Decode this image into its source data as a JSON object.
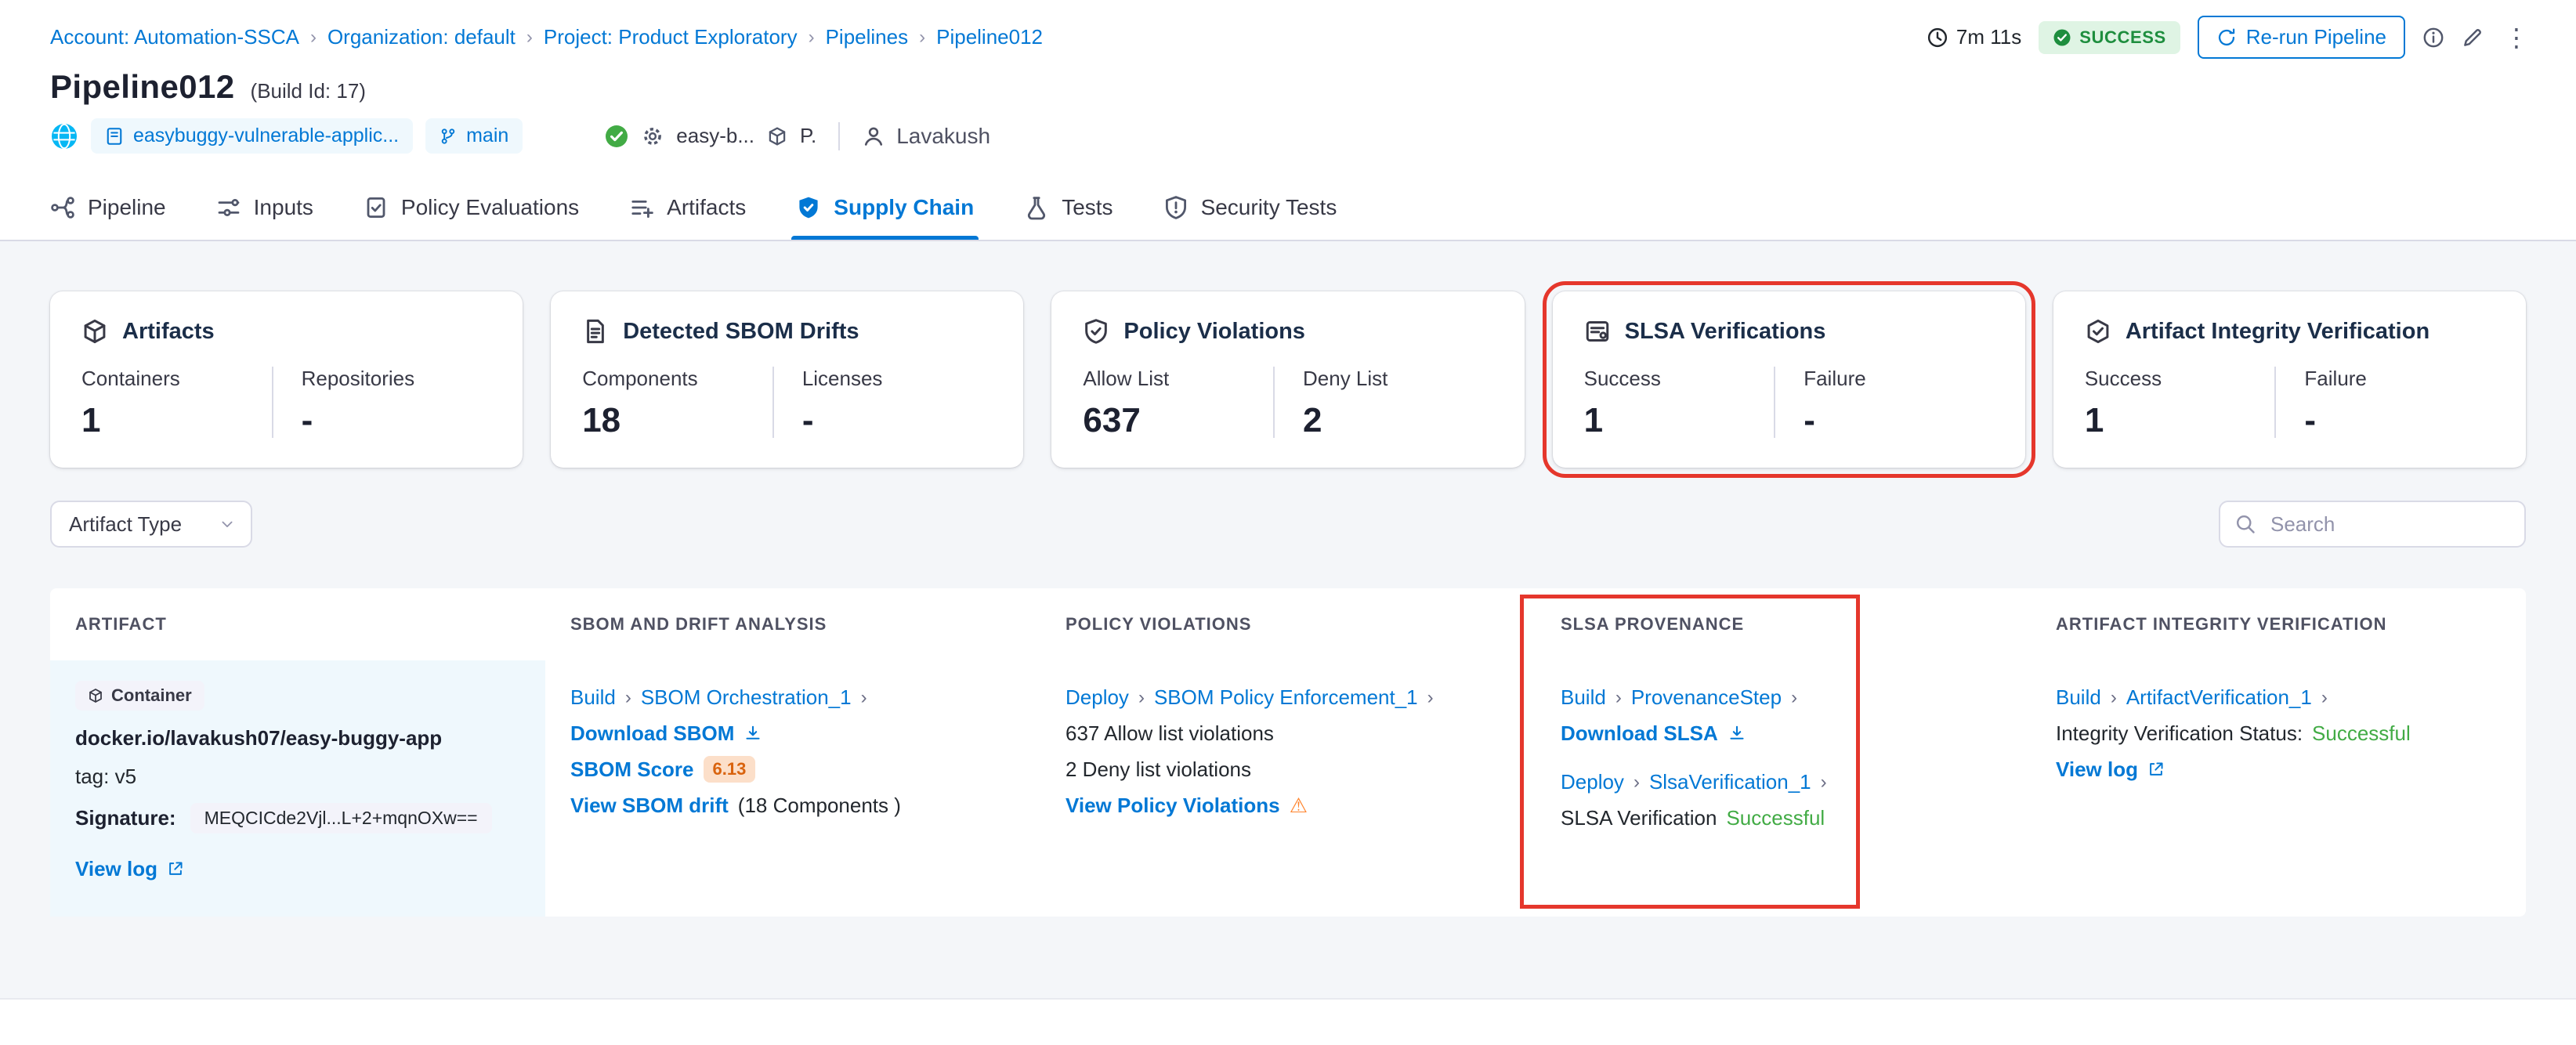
{
  "breadcrumb": {
    "items": [
      "Account: Automation-SSCA",
      "Organization: default",
      "Project: Product Exploratory",
      "Pipelines",
      "Pipeline012"
    ]
  },
  "header": {
    "duration": "7m 11s",
    "status_badge": "SUCCESS",
    "rerun_button": "Re-run Pipeline",
    "title": "Pipeline012",
    "build_id": "(Build Id: 17)"
  },
  "meta": {
    "repo": "easybuggy-vulnerable-applic...",
    "branch": "main",
    "trigger": "easy-b...",
    "trigger_short": "P.",
    "user": "Lavakush"
  },
  "tabs": [
    {
      "label": "Pipeline"
    },
    {
      "label": "Inputs"
    },
    {
      "label": "Policy Evaluations"
    },
    {
      "label": "Artifacts"
    },
    {
      "label": "Supply Chain",
      "active": true
    },
    {
      "label": "Tests"
    },
    {
      "label": "Security Tests"
    }
  ],
  "cards": [
    {
      "title": "Artifacts",
      "columns": [
        {
          "label": "Containers",
          "value": "1"
        },
        {
          "label": "Repositories",
          "value": "-"
        }
      ]
    },
    {
      "title": "Detected SBOM Drifts",
      "columns": [
        {
          "label": "Components",
          "value": "18"
        },
        {
          "label": "Licenses",
          "value": "-"
        }
      ]
    },
    {
      "title": "Policy Violations",
      "columns": [
        {
          "label": "Allow List",
          "value": "637"
        },
        {
          "label": "Deny List",
          "value": "2"
        }
      ]
    },
    {
      "title": "SLSA Verifications",
      "highlighted": true,
      "columns": [
        {
          "label": "Success",
          "value": "1"
        },
        {
          "label": "Failure",
          "value": "-"
        }
      ]
    },
    {
      "title": "Artifact Integrity Verification",
      "columns": [
        {
          "label": "Success",
          "value": "1"
        },
        {
          "label": "Failure",
          "value": "-"
        }
      ]
    }
  ],
  "filters": {
    "artifact_type": "Artifact Type",
    "search_placeholder": "Search"
  },
  "table": {
    "columns": [
      "ARTIFACT",
      "SBOM AND DRIFT ANALYSIS",
      "POLICY VIOLATIONS",
      "SLSA PROVENANCE",
      "ARTIFACT INTEGRITY VERIFICATION"
    ],
    "row": {
      "artifact": {
        "type_badge": "Container",
        "image": "docker.io/lavakush07/easy-buggy-app",
        "tag": "tag: v5",
        "signature_label": "Signature:",
        "signature_value": "MEQCICde2Vjl...L+2+mqnOXw==",
        "view_log": "View log"
      },
      "sbom": {
        "stage": "Build",
        "step": "SBOM Orchestration_1",
        "download": "Download SBOM",
        "score_label": "SBOM Score",
        "score_value": "6.13",
        "drift_link": "View SBOM drift",
        "drift_count": "(18 Components )"
      },
      "policy": {
        "stage": "Deploy",
        "step": "SBOM Policy Enforcement_1",
        "allow_violations": "637 Allow list violations",
        "deny_violations": "2 Deny list violations",
        "view_link": "View Policy Violations"
      },
      "slsa": {
        "stage1": "Build",
        "step1": "ProvenanceStep",
        "download": "Download SLSA",
        "stage2": "Deploy",
        "step2": "SlsaVerification_1",
        "status_label": "SLSA Verification",
        "status_value": "Successful"
      },
      "integrity": {
        "stage": "Build",
        "step": "ArtifactVerification_1",
        "status_label": "Integrity Verification Status:",
        "status_value": "Successful",
        "view_log": "View log"
      }
    }
  },
  "icons": {
    "chevron_right": "›",
    "kebab": "⋮",
    "warning": "⚠"
  },
  "colors": {
    "accent_blue": "#0278d5",
    "success_green": "#1e8e3e",
    "status_green": "#42ab45",
    "warning_orange": "#ff832b",
    "highlight_red": "#e5372c",
    "page_bg": "#f4f6f9"
  }
}
